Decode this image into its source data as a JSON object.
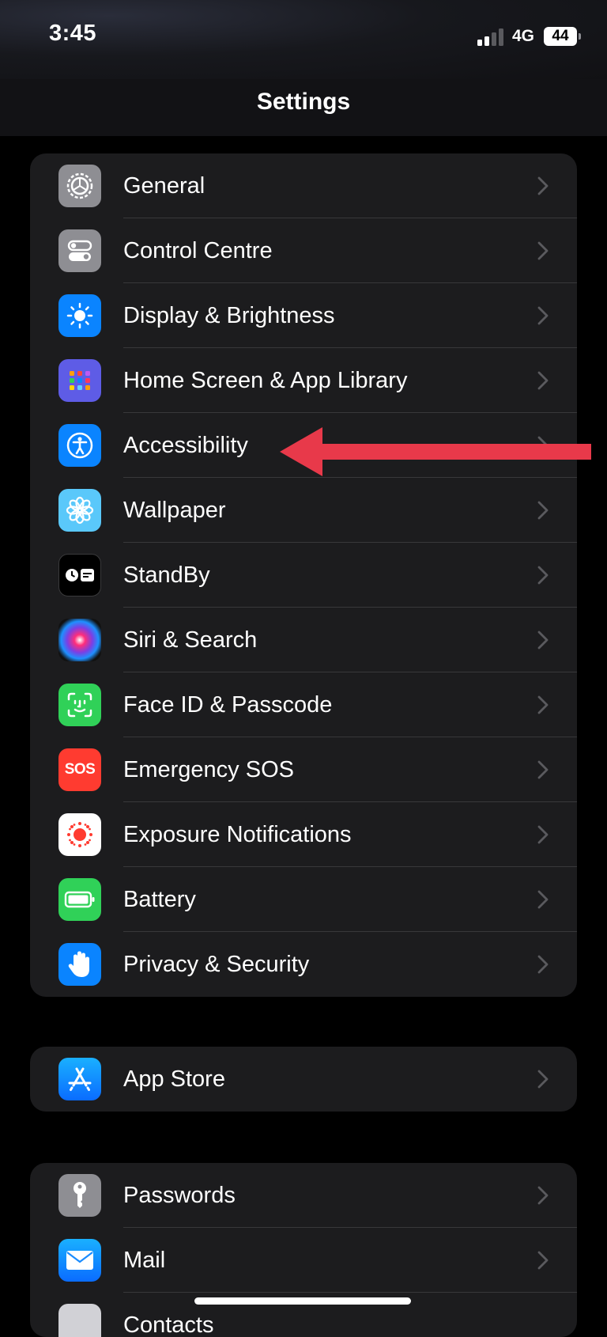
{
  "status_bar": {
    "time": "3:45",
    "network": "4G",
    "battery": "44"
  },
  "header": {
    "title": "Settings"
  },
  "groups": [
    {
      "items": [
        {
          "label": "General",
          "icon": "gear-icon",
          "color": "#8e8e93"
        },
        {
          "label": "Control Centre",
          "icon": "toggles-icon",
          "color": "#8e8e93"
        },
        {
          "label": "Display & Brightness",
          "icon": "sun-icon",
          "color": "#0a84ff"
        },
        {
          "label": "Home Screen & App Library",
          "icon": "app-grid-icon",
          "color": "#5e5ce6"
        },
        {
          "label": "Accessibility",
          "icon": "accessibility-icon",
          "color": "#0a84ff"
        },
        {
          "label": "Wallpaper",
          "icon": "flower-icon",
          "color": "#5ac8fa"
        },
        {
          "label": "StandBy",
          "icon": "standby-icon",
          "color": "#000000"
        },
        {
          "label": "Siri & Search",
          "icon": "siri-icon",
          "color": "#1c1c1e"
        },
        {
          "label": "Face ID & Passcode",
          "icon": "face-id-icon",
          "color": "#30d158"
        },
        {
          "label": "Emergency SOS",
          "icon": "sos-icon",
          "color": "#ff3b30"
        },
        {
          "label": "Exposure Notifications",
          "icon": "exposure-icon",
          "color": "#ffffff"
        },
        {
          "label": "Battery",
          "icon": "battery-icon",
          "color": "#30d158"
        },
        {
          "label": "Privacy & Security",
          "icon": "hand-icon",
          "color": "#0a84ff"
        }
      ]
    },
    {
      "items": [
        {
          "label": "App Store",
          "icon": "app-store-icon",
          "color": "#0a84ff"
        }
      ]
    },
    {
      "items": [
        {
          "label": "Passwords",
          "icon": "key-icon",
          "color": "#8e8e93"
        },
        {
          "label": "Mail",
          "icon": "mail-icon",
          "color": "#0a84ff"
        },
        {
          "label": "Contacts",
          "icon": "contacts-icon",
          "color": "#8e8e93"
        }
      ]
    }
  ],
  "annotation": {
    "arrow_color": "#e8394a"
  },
  "sos_text": "SOS"
}
